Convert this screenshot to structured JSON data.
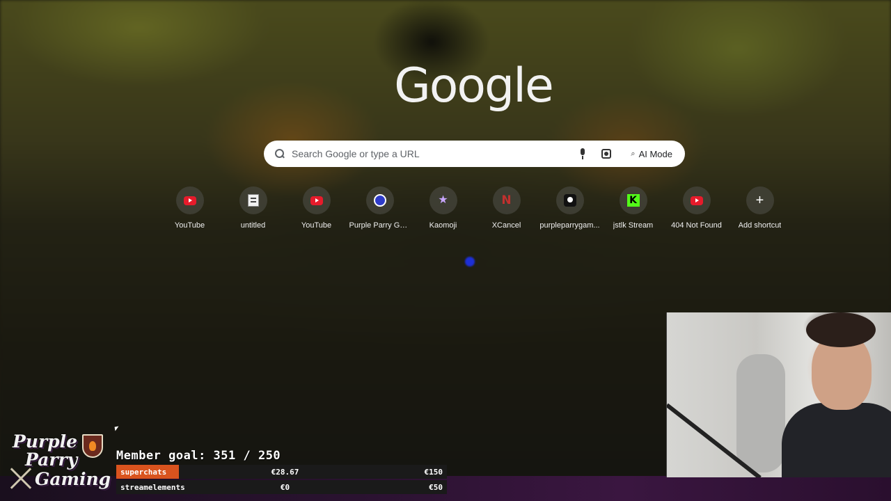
{
  "google": {
    "logo_text": "Google",
    "search_placeholder": "Search Google or type a URL",
    "ai_mode_label": "AI Mode"
  },
  "shortcuts": [
    {
      "label": "YouTube",
      "icon": "youtube-icon"
    },
    {
      "label": "untitled",
      "icon": "document-icon"
    },
    {
      "label": "YouTube",
      "icon": "youtube-icon"
    },
    {
      "label": "Purple Parry Ga...",
      "icon": "purple-parry-icon"
    },
    {
      "label": "Kaomoji",
      "icon": "kaomoji-icon"
    },
    {
      "label": "XCancel",
      "icon": "xcancel-icon"
    },
    {
      "label": "purpleparrygam...",
      "icon": "patreon-icon"
    },
    {
      "label": "jstlk Stream",
      "icon": "kick-icon"
    },
    {
      "label": "404 Not Found",
      "icon": "youtube-icon"
    },
    {
      "label": "Add shortcut",
      "icon": "plus-icon"
    }
  ],
  "overlay": {
    "brand_line1": "Purple",
    "brand_line2": "Parry",
    "brand_line3": "Gaming",
    "member_goal": "Member goal: 351 / 250",
    "goals": [
      {
        "name": "superchats",
        "current": "€28.67",
        "target": "€150",
        "progress": 0.19
      },
      {
        "name": "streamelements",
        "current": "€0",
        "target": "€50",
        "progress": 0
      }
    ]
  },
  "colors": {
    "youtube_red": "#e61b2b",
    "kick_green": "#53fc18",
    "goal_fill": "#d9531e",
    "search_bg": "#ffffff"
  }
}
